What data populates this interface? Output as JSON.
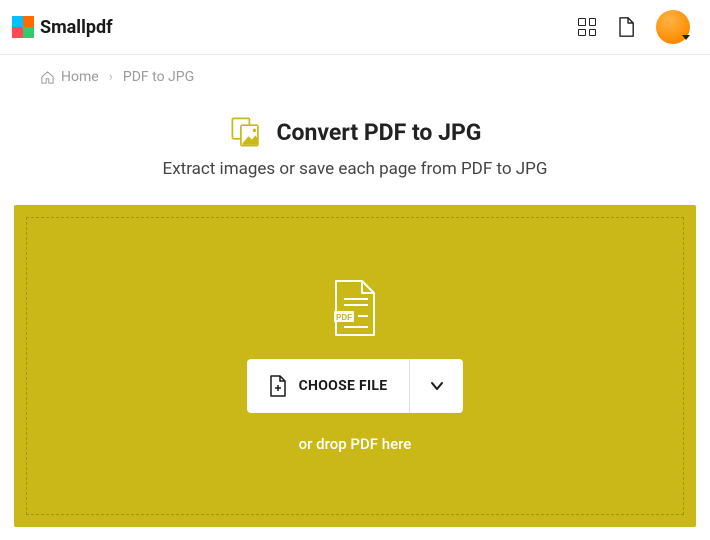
{
  "header": {
    "brand": "Smallpdf"
  },
  "breadcrumb": {
    "home": "Home",
    "current": "PDF to JPG"
  },
  "title": {
    "heading": "Convert PDF to JPG",
    "subtitle": "Extract images or save each page from PDF to JPG"
  },
  "dropzone": {
    "pdf_badge": "PDF",
    "choose_label": "CHOOSE FILE",
    "hint": "or drop PDF here"
  },
  "colors": {
    "accent": "#cab818"
  }
}
